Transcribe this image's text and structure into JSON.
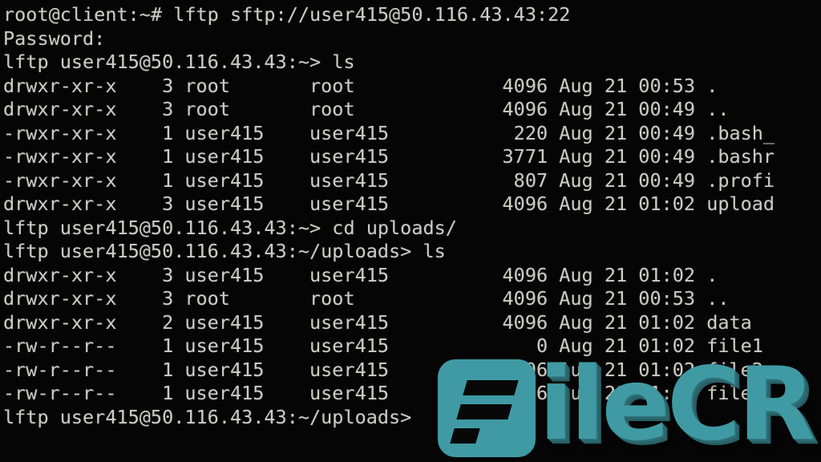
{
  "terminal": {
    "background_color": "#050505",
    "text_color": "#ccccc4",
    "shell_prompt": "root@client:~#",
    "command": "lftp sftp://user415@50.116.43.43:22",
    "lines": [
      "root@client:~# lftp sftp://user415@50.116.43.43:22",
      "Password:",
      "lftp user415@50.116.43.43:~> ls",
      "drwxr-xr-x    3 root       root             4096 Aug 21 00:53 .",
      "drwxr-xr-x    3 root       root             4096 Aug 21 00:49 ..",
      "-rwxr-xr-x    1 user415    user415           220 Aug 21 00:49 .bash_",
      "-rwxr-xr-x    1 user415    user415          3771 Aug 21 00:49 .bashr",
      "-rwxr-xr-x    1 user415    user415           807 Aug 21 00:49 .profi",
      "drwxr-xr-x    3 user415    user415          4096 Aug 21 01:02 upload",
      "lftp user415@50.116.43.43:~> cd uploads/",
      "lftp user415@50.116.43.43:~/uploads> ls",
      "drwxr-xr-x    3 user415    user415          4096 Aug 21 01:02 .",
      "drwxr-xr-x    3 root       root             4096 Aug 21 00:53 ..",
      "drwxr-xr-x    2 user415    user415          4096 Aug 21 01:02 data",
      "-rw-r--r--    1 user415    user415             0 Aug 21 01:02 file1",
      "-rw-r--r--    1 user415    user415          4096 Aug 21 01:02 file2",
      "-rw-r--r--    1 user415    user415          4096 Aug 21 01:02 file3",
      "lftp user415@50.116.43.43:~/uploads>"
    ],
    "directory_listings": [
      {
        "path": "~",
        "command": "ls",
        "entries": [
          {
            "perms": "drwxr-xr-x",
            "links": "3",
            "owner": "root",
            "group": "root",
            "size": "4096",
            "month": "Aug",
            "day": "21",
            "time": "00:53",
            "name": "."
          },
          {
            "perms": "drwxr-xr-x",
            "links": "3",
            "owner": "root",
            "group": "root",
            "size": "4096",
            "month": "Aug",
            "day": "21",
            "time": "00:49",
            "name": ".."
          },
          {
            "perms": "-rwxr-xr-x",
            "links": "1",
            "owner": "user415",
            "group": "user415",
            "size": "220",
            "month": "Aug",
            "day": "21",
            "time": "00:49",
            "name": ".bash_"
          },
          {
            "perms": "-rwxr-xr-x",
            "links": "1",
            "owner": "user415",
            "group": "user415",
            "size": "3771",
            "month": "Aug",
            "day": "21",
            "time": "00:49",
            "name": ".bashr"
          },
          {
            "perms": "-rwxr-xr-x",
            "links": "1",
            "owner": "user415",
            "group": "user415",
            "size": "807",
            "month": "Aug",
            "day": "21",
            "time": "00:49",
            "name": ".profi"
          },
          {
            "perms": "drwxr-xr-x",
            "links": "3",
            "owner": "user415",
            "group": "user415",
            "size": "4096",
            "month": "Aug",
            "day": "21",
            "time": "01:02",
            "name": "upload"
          }
        ]
      },
      {
        "path": "~/uploads",
        "command": "ls",
        "entries": [
          {
            "perms": "drwxr-xr-x",
            "links": "3",
            "owner": "user415",
            "group": "user415",
            "size": "4096",
            "month": "Aug",
            "day": "21",
            "time": "01:02",
            "name": "."
          },
          {
            "perms": "drwxr-xr-x",
            "links": "3",
            "owner": "root",
            "group": "root",
            "size": "4096",
            "month": "Aug",
            "day": "21",
            "time": "00:53",
            "name": ".."
          },
          {
            "perms": "drwxr-xr-x",
            "links": "2",
            "owner": "user415",
            "group": "user415",
            "size": "4096",
            "month": "Aug",
            "day": "21",
            "time": "01:02",
            "name": "data"
          },
          {
            "perms": "-rw-r--r--",
            "links": "1",
            "owner": "user415",
            "group": "user415",
            "size": "0",
            "month": "Aug",
            "day": "21",
            "time": "01:02",
            "name": "file1"
          },
          {
            "perms": "-rw-r--r--",
            "links": "1",
            "owner": "user415",
            "group": "user415",
            "size": "4096",
            "month": "Aug",
            "day": "21",
            "time": "01:02",
            "name": "file2"
          },
          {
            "perms": "-rw-r--r--",
            "links": "1",
            "owner": "user415",
            "group": "user415",
            "size": "4096",
            "month": "Aug",
            "day": "21",
            "time": "01:02",
            "name": "file3"
          }
        ]
      }
    ],
    "lftp_prompts": [
      "lftp user415@50.116.43.43:~>",
      "lftp user415@50.116.43.43:~/uploads>"
    ],
    "password_prompt": "Password:",
    "commands_entered": [
      "ls",
      "cd uploads/",
      "ls"
    ],
    "host": "50.116.43.43",
    "port": "22",
    "user": "user415"
  },
  "watermark": {
    "brand_text": "ileCR",
    "full_brand": "FileCR",
    "mark_letter": "F",
    "teal_color": "#3f9aa4",
    "shadow_color": "#2a666c"
  }
}
